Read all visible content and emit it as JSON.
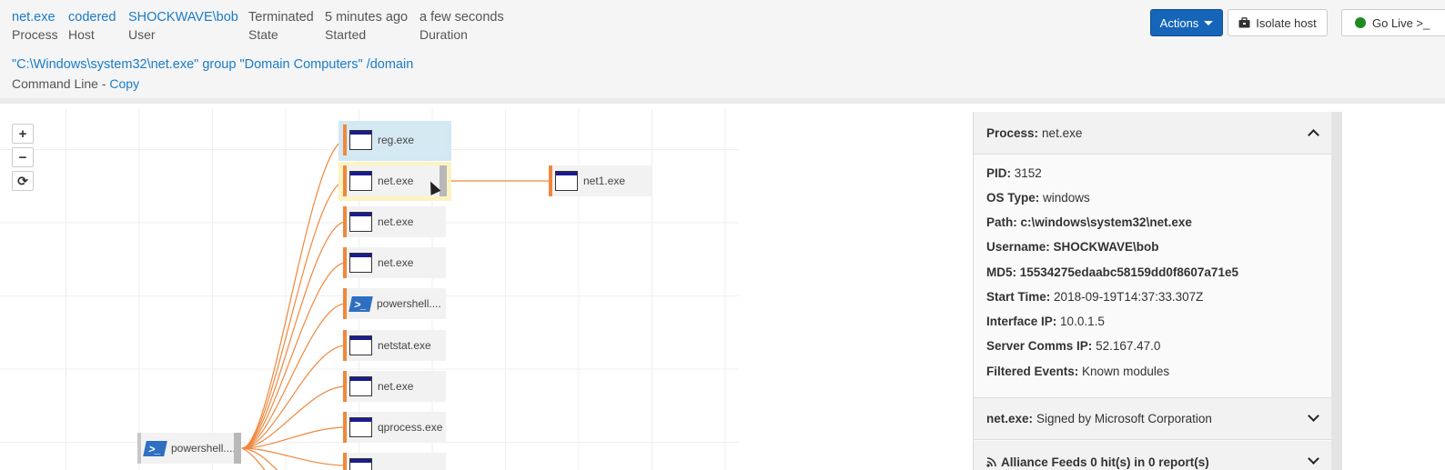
{
  "header": {
    "meta": [
      {
        "value": "net.exe",
        "label": "Process",
        "link": true
      },
      {
        "value": "codered",
        "label": "Host",
        "link": true
      },
      {
        "value": "SHOCKWAVE\\bob",
        "label": "User",
        "link": true
      },
      {
        "value": "Terminated",
        "label": "State",
        "link": false
      },
      {
        "value": "5 minutes ago",
        "label": "Started",
        "link": false
      },
      {
        "value": "a few seconds",
        "label": "Duration",
        "link": false
      }
    ],
    "command_line": "\"C:\\Windows\\system32\\net.exe\" group \"Domain Computers\" /domain",
    "command_line_label": "Command Line - ",
    "copy_label": "Copy",
    "buttons": {
      "actions": "Actions",
      "isolate": "Isolate host",
      "go_live": "Go Live >_"
    },
    "colors": {
      "link": "#1a7bc9",
      "primary": "#1565b8",
      "live": "#1f8a1f"
    }
  },
  "graph": {
    "zoom_in": "+",
    "zoom_out": "−",
    "refresh": "⟳",
    "root": {
      "label": "powershell....",
      "icon": "powershell-icon"
    },
    "children": [
      {
        "label": "reg.exe",
        "icon": "window-icon",
        "state": "hovered"
      },
      {
        "label": "net.exe",
        "icon": "window-icon",
        "state": "selected"
      },
      {
        "label": "net.exe",
        "icon": "window-icon"
      },
      {
        "label": "net.exe",
        "icon": "window-icon"
      },
      {
        "label": "powershell....",
        "icon": "powershell-icon"
      },
      {
        "label": "netstat.exe",
        "icon": "window-icon"
      },
      {
        "label": "net.exe",
        "icon": "window-icon"
      },
      {
        "label": "qprocess.exe",
        "icon": "window-icon"
      }
    ],
    "grandchild": {
      "label": "net1.exe",
      "icon": "window-icon"
    },
    "edge_color": "#f0883c"
  },
  "panel": {
    "process_header_key": "Process:",
    "process_header_value": "net.exe",
    "rows": [
      {
        "key": "PID:",
        "value": "3152",
        "bold": false
      },
      {
        "key": "OS Type:",
        "value": "windows",
        "bold": false
      },
      {
        "key": "Path:",
        "value": "c:\\windows\\system32\\net.exe",
        "bold": true
      },
      {
        "key": "Username:",
        "value": "SHOCKWAVE\\bob",
        "bold": true
      },
      {
        "key": "MD5:",
        "value": "15534275edaabc58159dd0f8607a71e5",
        "bold": true
      },
      {
        "key": "Start Time:",
        "value": "2018-09-19T14:37:33.307Z",
        "bold": false
      },
      {
        "key": "Interface IP:",
        "value": "10.0.1.5",
        "bold": false
      },
      {
        "key": "Server Comms IP:",
        "value": "52.167.47.0",
        "bold": false
      },
      {
        "key": "Filtered Events:",
        "value": "Known modules",
        "bold": false
      }
    ],
    "signed_key": "net.exe:",
    "signed_value": "Signed by Microsoft Corporation",
    "alliance": "Alliance Feeds 0 hit(s) in 0 report(s)"
  }
}
